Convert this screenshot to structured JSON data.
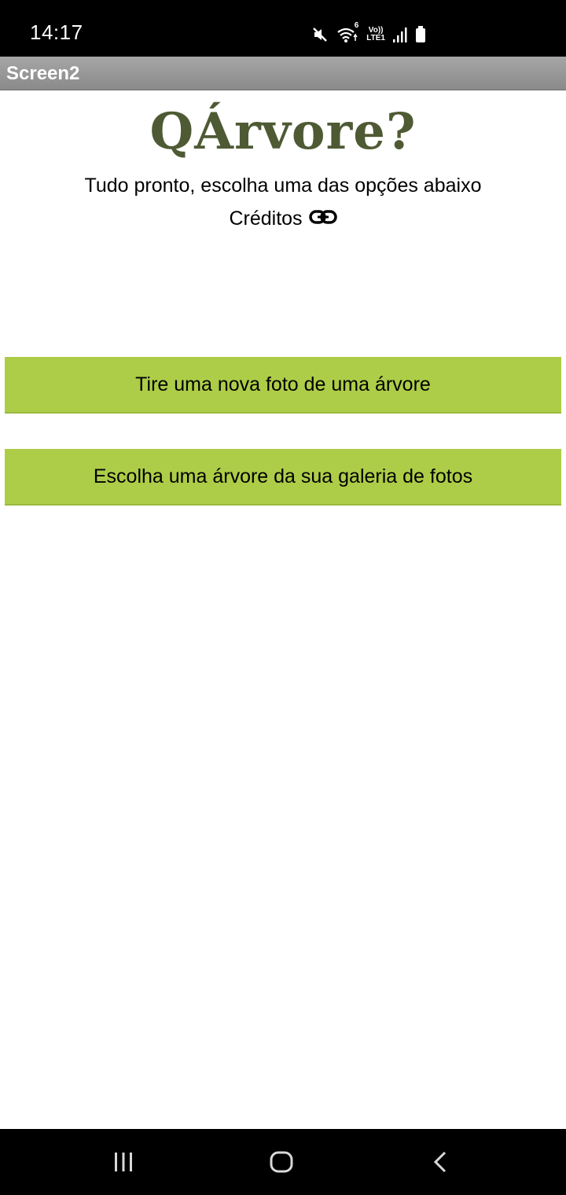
{
  "status_bar": {
    "time": "14:17",
    "network_label_top": "Vo))",
    "network_label_bottom": "LTE1",
    "wifi_badge": "6",
    "icons": [
      "mute-icon",
      "wifi-icon",
      "lte-icon",
      "signal-icon",
      "battery-icon"
    ]
  },
  "app": {
    "screen_title": "Screen2",
    "logo_text": "QÁrvore?",
    "subtitle": "Tudo pronto, escolha uma das opções abaixo",
    "credits_label": "Créditos",
    "credits_icon": "link-icon"
  },
  "buttons": {
    "take_photo": "Tire uma nova foto de uma árvore",
    "choose_gallery": "Escolha uma árvore da sua galeria de fotos"
  },
  "colors": {
    "button_bg": "#adcd48",
    "logo": "#4e5a34",
    "title_bar": "#9a9a9a"
  },
  "nav_bar": {
    "icons": [
      "recent-apps-icon",
      "home-icon",
      "back-icon"
    ]
  }
}
